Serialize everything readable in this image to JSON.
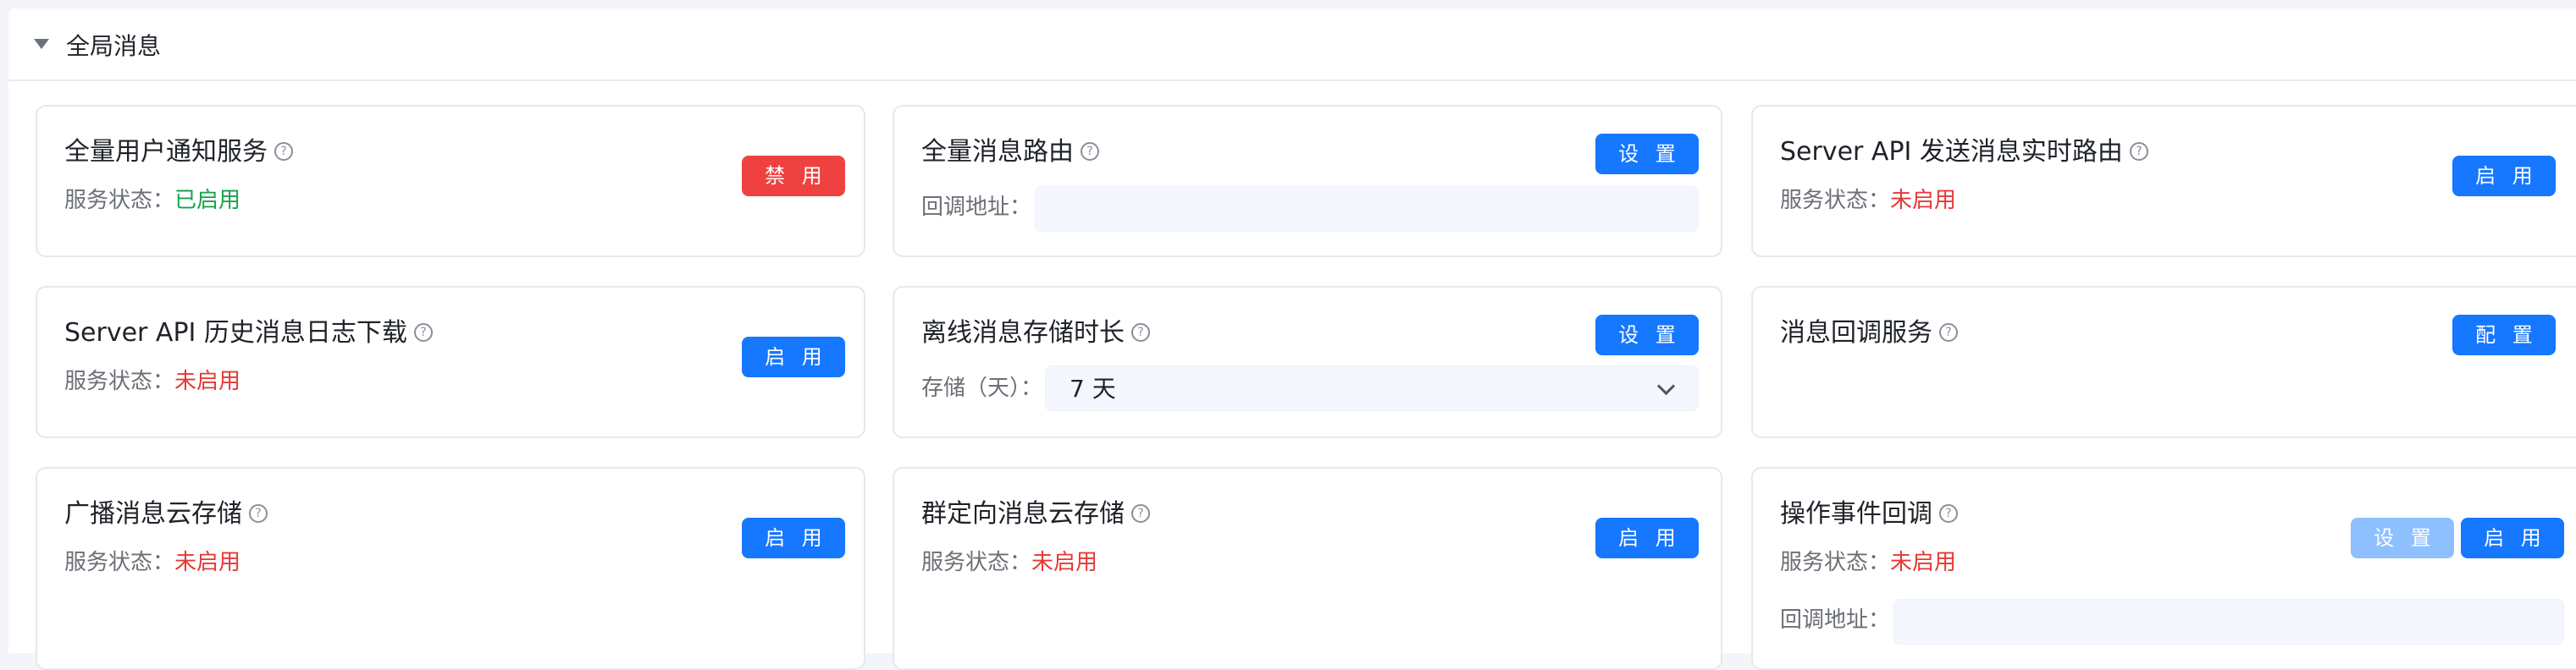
{
  "section": {
    "title": "全局消息",
    "caret": "caret-down-icon"
  },
  "help_glyph": "?",
  "status_label": "服务状态：",
  "cards": [
    {
      "title": "全量用户通知服务",
      "status": "已启用",
      "button": "禁 用"
    },
    {
      "title": "全量消息路由",
      "button": "设 置",
      "field_label": "回调地址：",
      "field_value": ""
    },
    {
      "title": "Server API 发送消息实时路由",
      "status": "未启用",
      "button": "启 用"
    },
    {
      "title": "Server API 历史消息日志下载",
      "status": "未启用",
      "button": "启 用"
    },
    {
      "title": "离线消息存储时长",
      "button": "设 置",
      "field_label": "存储（天）：",
      "select_value": "7 天"
    },
    {
      "title": "消息回调服务",
      "button": "配 置"
    },
    {
      "title": "广播消息云存储",
      "status": "未启用",
      "button": "启 用"
    },
    {
      "title": "群定向消息云存储",
      "status": "未启用",
      "button": "启 用"
    },
    {
      "title": "操作事件回调",
      "status": "未启用",
      "button_secondary": "设 置",
      "button": "启 用",
      "field_label": "回调地址：",
      "field_value": ""
    }
  ],
  "colors": {
    "primary": "#1677ff",
    "danger": "#f04141",
    "disabled_primary": "#8ec0ff",
    "status_enabled": "#16a34a",
    "status_disabled": "#e53935"
  }
}
